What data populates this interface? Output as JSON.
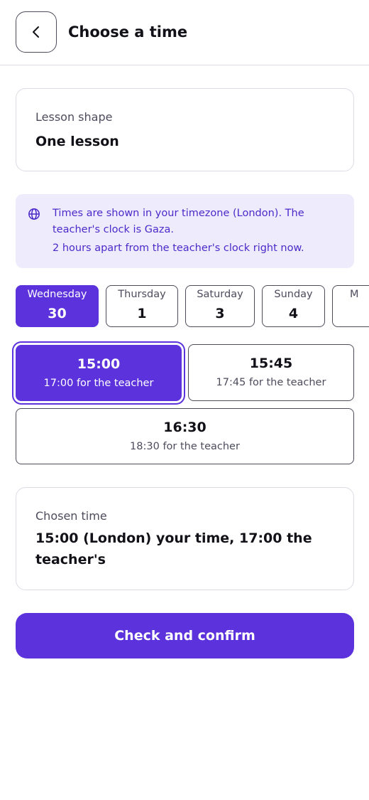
{
  "header": {
    "title": "Choose a time",
    "back_icon": "chevron-left-icon"
  },
  "lesson_shape": {
    "label": "Lesson shape",
    "value": "One lesson"
  },
  "timezone_notice": {
    "icon": "globe-icon",
    "line1": "Times are shown in your timezone (London). The teacher's clock is Gaza.",
    "line2": "2 hours apart from the teacher's clock right now."
  },
  "days": [
    {
      "name": "Wednesday",
      "number": "30",
      "selected": true
    },
    {
      "name": "Thursday",
      "number": "1",
      "selected": false
    },
    {
      "name": "Saturday",
      "number": "3",
      "selected": false
    },
    {
      "name": "Sunday",
      "number": "4",
      "selected": false
    },
    {
      "name": "M",
      "number": "",
      "selected": false
    }
  ],
  "slots": [
    {
      "time": "15:00",
      "teacher": "17:00 for the teacher",
      "selected": true
    },
    {
      "time": "15:45",
      "teacher": "17:45 for the teacher",
      "selected": false
    },
    {
      "time": "16:30",
      "teacher": "18:30 for the teacher",
      "selected": false
    }
  ],
  "chosen": {
    "label": "Chosen time",
    "value": "15:00 (London) your time, 17:00 the teacher's"
  },
  "confirm": {
    "label": "Check and confirm"
  },
  "colors": {
    "accent": "#5b32dc",
    "notice_bg": "#eeebfd",
    "notice_text": "#4b2ac9",
    "border": "#dcdce5"
  }
}
